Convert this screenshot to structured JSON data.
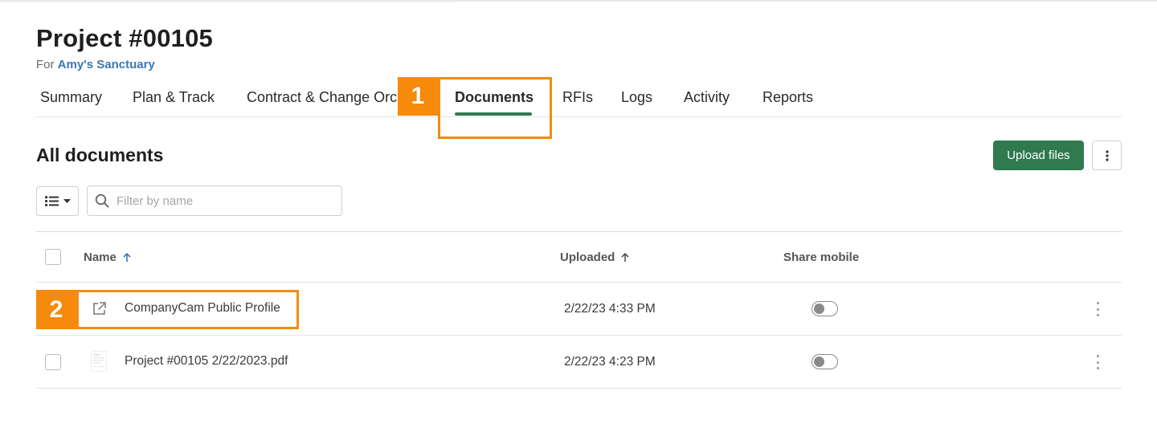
{
  "header": {
    "title": "Project #00105",
    "for_label": "For",
    "client": "Amy's Sanctuary"
  },
  "tabs": [
    {
      "label": "Summary"
    },
    {
      "label": "Plan & Track"
    },
    {
      "label": "Contract & Change Orc"
    },
    {
      "label": "Documents",
      "active": true
    },
    {
      "label": "RFIs"
    },
    {
      "label": "Logs"
    },
    {
      "label": "Activity"
    },
    {
      "label": "Reports"
    }
  ],
  "callouts": {
    "one": "1",
    "two": "2"
  },
  "section": {
    "title": "All documents",
    "upload_label": "Upload files",
    "more_icon": "vertical-ellipsis-icon"
  },
  "toolbar": {
    "view_icon": "list-view-icon",
    "search_placeholder": "Filter by name"
  },
  "table": {
    "columns": {
      "name": "Name",
      "uploaded": "Uploaded",
      "share_mobile": "Share mobile"
    },
    "rows": [
      {
        "name": "CompanyCam Public Profile",
        "uploaded": "2/22/23 4:33 PM",
        "share_mobile": false,
        "icon": "external-link-icon"
      },
      {
        "name": "Project #00105 2/22/2023.pdf",
        "uploaded": "2/22/23 4:23 PM",
        "share_mobile": false,
        "icon": "pdf-thumbnail-icon"
      }
    ]
  },
  "colors": {
    "accent": "#2f7a4f",
    "link": "#3a78b7",
    "callout": "#f58a0b"
  }
}
